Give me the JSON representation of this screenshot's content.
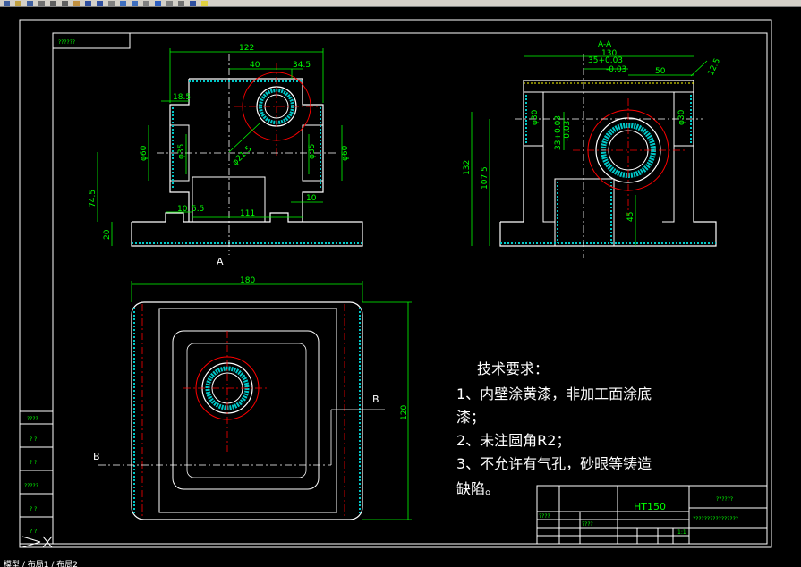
{
  "toolbar": {
    "icons": [
      "toolbar-icon"
    ]
  },
  "front_view": {
    "dims": {
      "d122": "122",
      "d40": "40",
      "d34_5": "34.5",
      "d18_5": "18.5",
      "d60_left": "φ60",
      "d35_left": "φ35",
      "d35_right": "φ35",
      "d60_right": "φ60",
      "d21_5": "φ21.5",
      "d74_5": "74.5",
      "d20": "20",
      "d10a": "10",
      "d5_5": "5.5",
      "d111": "111",
      "d10b": "10"
    },
    "section_mark": "A",
    "corner_label": "??????"
  },
  "side_view": {
    "title": "A-A",
    "dims": {
      "d130": "130",
      "d35tol": "35+0.03",
      "d35tol2": "-0.03",
      "d50": "50",
      "d12_5": "12.5",
      "d30_left": "φ30",
      "d30_right": "φ30",
      "d33tol": "33+0.03",
      "d33tol2": "-0.03",
      "d132": "132",
      "d107_5": "107.5",
      "d45": "45"
    }
  },
  "top_view": {
    "dims": {
      "d180": "180",
      "d120": "120"
    },
    "mark_b_left": "B",
    "mark_b_right": "B"
  },
  "tech_requirements": {
    "title": "技术要求：",
    "lines": [
      "1、内壁涂黄漆，非加工面涂底",
      "漆；",
      "2、未注圆角R2；",
      "3、不允许有气孔，砂眼等铸造",
      "缺陷。"
    ]
  },
  "title_block": {
    "material": "HT150",
    "cell_a": "????",
    "cell_b": "????",
    "cell_c": "1:1",
    "cell_d": "??????",
    "cell_e": "????????????????"
  },
  "left_table": {
    "header": "????",
    "rows": [
      "? ?",
      "? ?",
      "?????",
      "? ?",
      "? ?"
    ]
  },
  "status": {
    "text": "模型 / 布局1 / 布局2"
  },
  "colors": {
    "background": "#000000",
    "line_green": "#00ff00",
    "line_white": "#ffffff",
    "line_red": "#ff0000",
    "line_yellow": "#ffff00",
    "hatch_cyan": "#00c8c8"
  }
}
